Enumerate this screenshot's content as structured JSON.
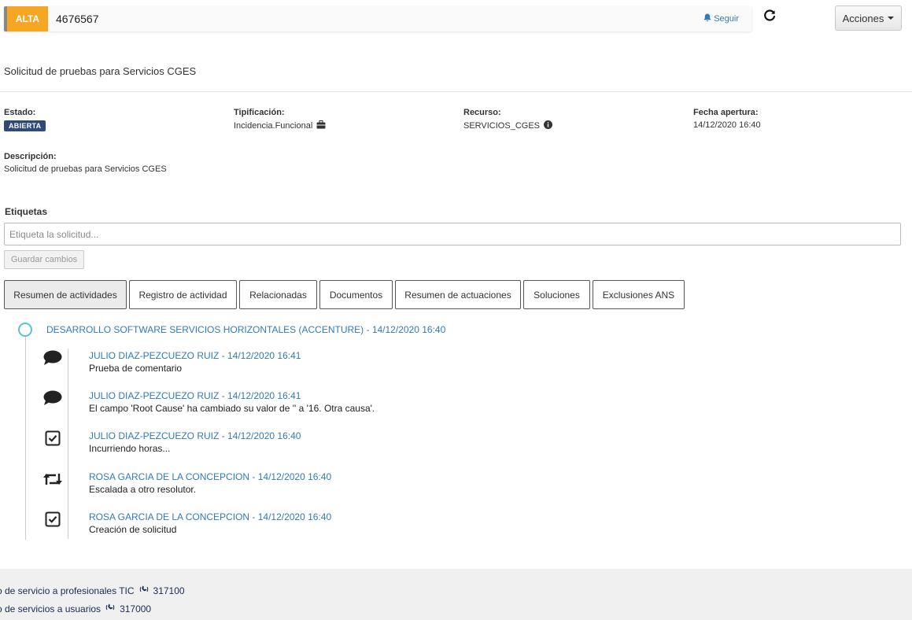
{
  "header": {
    "priority": "ALTA",
    "ticket_id": "4676567",
    "follow_label": "Seguir",
    "actions_label": "Acciones",
    "priority_color": "#f5a623"
  },
  "ticket": {
    "title": "Solicitud de pruebas para Servicios CGES",
    "estado_label": "Estado:",
    "estado_value": "ABIERTA",
    "tipificacion_label": "Tipificación:",
    "tipificacion_value": "Incidencia.Funcional",
    "recurso_label": "Recurso:",
    "recurso_value": "SERVICIOS_CGES",
    "fecha_label": "Fecha apertura:",
    "fecha_value": "14/12/2020 16:40",
    "descripcion_label": "Descripción:",
    "descripcion_value": "Solicitud de pruebas para Servicios CGES"
  },
  "tags": {
    "label": "Etiquetas",
    "placeholder": "Etiqueta la solicitud...",
    "save_label": "Guardar cambios"
  },
  "tabs": [
    {
      "label": "Resumen de actividades",
      "active": true
    },
    {
      "label": "Registro de actividad"
    },
    {
      "label": "Relacionadas"
    },
    {
      "label": "Documentos"
    },
    {
      "label": "Resumen de actuaciones"
    },
    {
      "label": "Soluciones"
    },
    {
      "label": "Exclusiones ANS"
    }
  ],
  "timeline": {
    "group_title": "DESARROLLO SOFTWARE SERVICIOS HORIZONTALES (ACCENTURE)  -  14/12/2020 16:40",
    "entries": [
      {
        "icon": "comment-icon",
        "author": "JULIO DIAZ-PEZCUEZO RUIZ  -  14/12/2020 16:41",
        "message": "Prueba de comentario"
      },
      {
        "icon": "comment-icon",
        "author": "JULIO DIAZ-PEZCUEZO RUIZ  -  14/12/2020 16:41",
        "message": "El campo 'Root Cause' ha cambiado su valor de '' a '16. Otra causa'."
      },
      {
        "icon": "checkbox-icon",
        "author": "JULIO DIAZ-PEZCUEZO RUIZ  -  14/12/2020 16:40",
        "message": "Incurriendo horas..."
      },
      {
        "icon": "retweet-icon",
        "author": "ROSA GARCIA DE LA CONCEPCION  -  14/12/2020 16:40",
        "message": "Escalada a otro resolutor."
      },
      {
        "icon": "checkbox-icon",
        "author": "ROSA GARCIA DE LA CONCEPCION  -  14/12/2020 16:40",
        "message": "Creación de solicitud"
      }
    ]
  },
  "footer": {
    "line1_text": "ro de servicio a profesionales TIC",
    "line1_phone": "317100",
    "line2_text": "ro de servicios a usuarios",
    "line2_phone": "317000"
  }
}
